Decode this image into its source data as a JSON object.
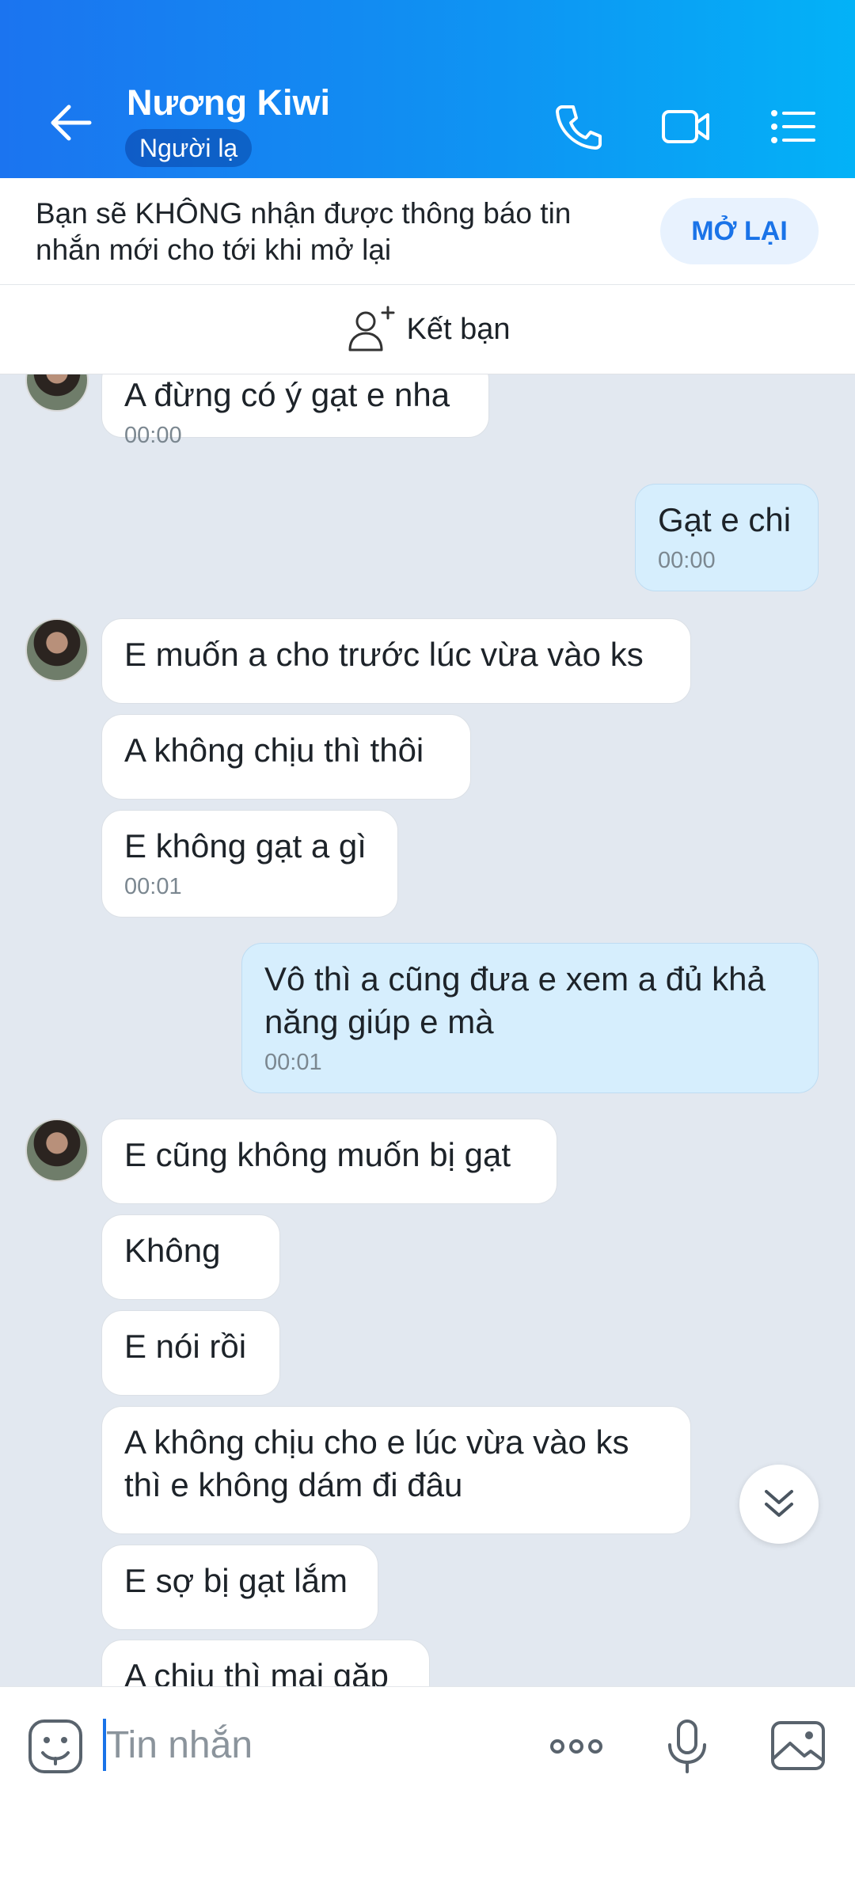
{
  "header": {
    "contact_name": "Nương Kiwi",
    "status_badge": "Người lạ"
  },
  "mute_notice": {
    "text": "Bạn sẽ KHÔNG nhận được thông báo tin nhắn mới cho tới khi mở lại",
    "button": "MỞ LẠI"
  },
  "add_friend": {
    "label": "Kết bạn"
  },
  "messages": [
    {
      "dir": "in",
      "text": "A đừng có ý gạt e nha",
      "time": "00:00"
    },
    {
      "dir": "out",
      "text": "Gạt e chi",
      "time": "00:00"
    },
    {
      "dir": "in",
      "text": "E muốn a cho trước lúc vừa vào ks",
      "time": ""
    },
    {
      "dir": "in",
      "text": "A không chịu thì thôi",
      "time": ""
    },
    {
      "dir": "in",
      "text": "E không gạt a gì",
      "time": "00:01"
    },
    {
      "dir": "out",
      "text": "Vô thì a cũng đưa e xem a đủ khả năng giúp e mà",
      "time": "00:01"
    },
    {
      "dir": "in",
      "text": "E cũng không muốn bị gạt",
      "time": ""
    },
    {
      "dir": "in",
      "text": "Không",
      "time": ""
    },
    {
      "dir": "in",
      "text": "E nói rồi",
      "time": ""
    },
    {
      "dir": "in",
      "text": "A không chịu cho e lúc vừa vào ks thì e không dám đi đâu",
      "time": ""
    },
    {
      "dir": "in",
      "text": "E sợ bị gạt lắm",
      "time": ""
    },
    {
      "dir": "in",
      "text": "A chịu thì mai gặp",
      "time": ""
    }
  ],
  "composer": {
    "placeholder": "Tin nhắn"
  },
  "colors": {
    "header_start": "#1b74f0",
    "header_end": "#03b2f7",
    "outgoing_bubble": "#d6eefd",
    "accent": "#1a73e8"
  },
  "icons": [
    "back-arrow-icon",
    "phone-icon",
    "video-call-icon",
    "menu-list-icon",
    "add-friend-icon",
    "chevron-double-down-icon",
    "emoji-icon",
    "more-dots-icon",
    "microphone-icon",
    "image-icon"
  ]
}
